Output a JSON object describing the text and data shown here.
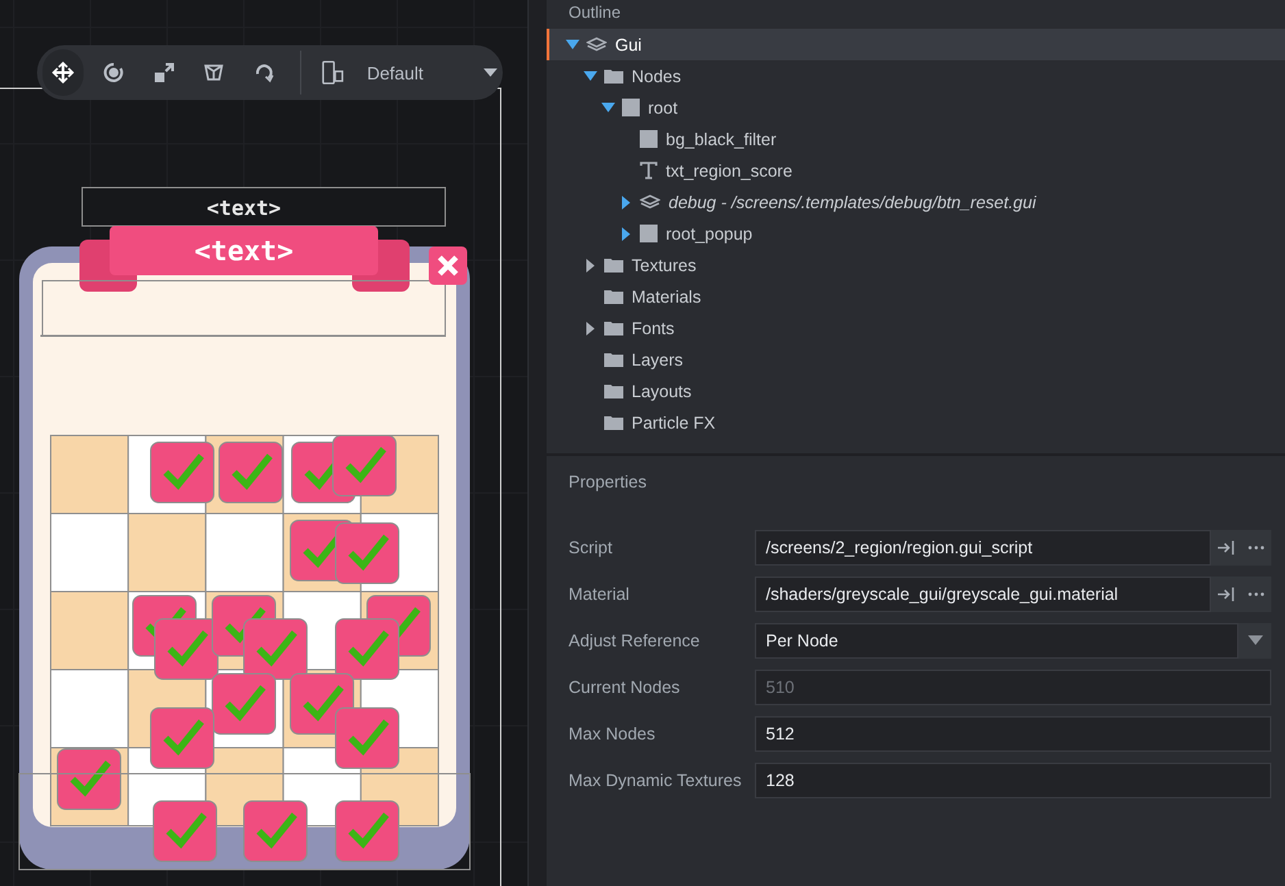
{
  "toolbar": {
    "tools": [
      {
        "kind": "move",
        "selected": true
      },
      {
        "kind": "rotate",
        "selected": false
      },
      {
        "kind": "scale",
        "selected": false
      },
      {
        "kind": "anchor",
        "selected": false
      },
      {
        "kind": "reset",
        "selected": false
      }
    ],
    "layout": "Default"
  },
  "canvas": {
    "title_text": "<text>",
    "banner_text": "<text>"
  },
  "outline": {
    "title": "Outline",
    "tree": [
      {
        "label": "Gui",
        "kind": "gui",
        "expanded": true,
        "selected": true,
        "children": [
          {
            "label": "Nodes",
            "kind": "folder",
            "expanded": true,
            "selected": false,
            "children": [
              {
                "label": "root",
                "kind": "box",
                "expanded": true,
                "selected": false,
                "children": [
                  {
                    "label": "bg_black_filter",
                    "kind": "box",
                    "selected": false
                  },
                  {
                    "label": "txt_region_score",
                    "kind": "text",
                    "selected": false
                  },
                  {
                    "label": "debug - /screens/.templates/debug/btn_reset.gui",
                    "kind": "template",
                    "expanded": false,
                    "selected": false
                  },
                  {
                    "label": "root_popup",
                    "kind": "box",
                    "expanded": false,
                    "selected": false
                  }
                ]
              }
            ]
          },
          {
            "label": "Textures",
            "kind": "folder",
            "expanded": false,
            "selected": false
          },
          {
            "label": "Materials",
            "kind": "folder",
            "selected": false
          },
          {
            "label": "Fonts",
            "kind": "folder",
            "expanded": false,
            "selected": false
          },
          {
            "label": "Layers",
            "kind": "folder",
            "selected": false
          },
          {
            "label": "Layouts",
            "kind": "folder",
            "selected": false
          },
          {
            "label": "Particle FX",
            "kind": "folder",
            "selected": false
          }
        ]
      }
    ]
  },
  "properties": {
    "title": "Properties",
    "rows": [
      {
        "label": "Script",
        "kind": "resource",
        "value": "/screens/2_region/region.gui_script",
        "disabled": false
      },
      {
        "label": "Material",
        "kind": "resource",
        "value": "/shaders/greyscale_gui/greyscale_gui.material",
        "disabled": false
      },
      {
        "label": "Adjust Reference",
        "kind": "select",
        "value": "Per Node",
        "disabled": false
      },
      {
        "label": "Current Nodes",
        "kind": "number",
        "value": "510",
        "disabled": true
      },
      {
        "label": "Max Nodes",
        "kind": "number",
        "value": "512",
        "disabled": false
      },
      {
        "label": "Max Dynamic Textures",
        "kind": "number",
        "value": "128",
        "disabled": false
      }
    ]
  }
}
